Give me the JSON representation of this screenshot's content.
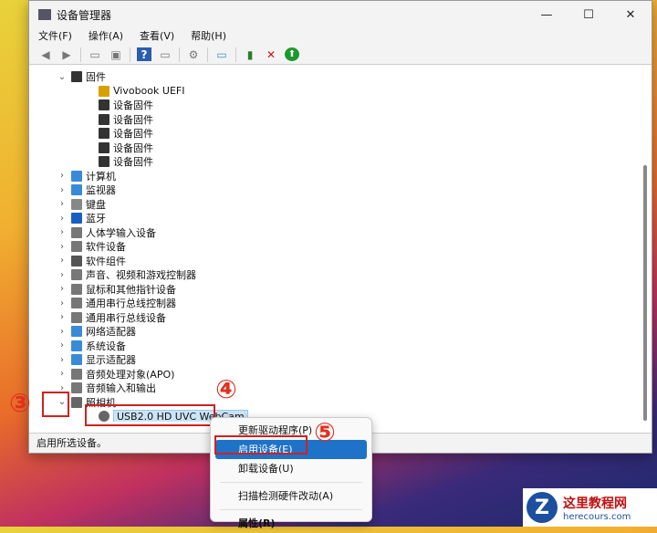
{
  "window": {
    "title": "设备管理器",
    "minimize": "—",
    "maximize": "☐",
    "close": "✕"
  },
  "menu": [
    "文件(F)",
    "操作(A)",
    "查看(V)",
    "帮助(H)"
  ],
  "tree": [
    {
      "label": "固件",
      "level": 0,
      "exp": "⌄",
      "color": "#333"
    },
    {
      "label": "Vivobook UEFI",
      "level": 1,
      "exp": "",
      "color": "#d9a000"
    },
    {
      "label": "设备固件",
      "level": 1,
      "exp": "",
      "color": "#333"
    },
    {
      "label": "设备固件",
      "level": 1,
      "exp": "",
      "color": "#333"
    },
    {
      "label": "设备固件",
      "level": 1,
      "exp": "",
      "color": "#333"
    },
    {
      "label": "设备固件",
      "level": 1,
      "exp": "",
      "color": "#333"
    },
    {
      "label": "设备固件",
      "level": 1,
      "exp": "",
      "color": "#333"
    },
    {
      "label": "计算机",
      "level": 0,
      "exp": "›",
      "color": "#3a8ad8"
    },
    {
      "label": "监视器",
      "level": 0,
      "exp": "›",
      "color": "#3a8ad8"
    },
    {
      "label": "键盘",
      "level": 0,
      "exp": "›",
      "color": "#888"
    },
    {
      "label": "蓝牙",
      "level": 0,
      "exp": "›",
      "color": "#1a5fc0"
    },
    {
      "label": "人体学输入设备",
      "level": 0,
      "exp": "›",
      "color": "#777"
    },
    {
      "label": "软件设备",
      "level": 0,
      "exp": "›",
      "color": "#777"
    },
    {
      "label": "软件组件",
      "level": 0,
      "exp": "›",
      "color": "#555"
    },
    {
      "label": "声音、视频和游戏控制器",
      "level": 0,
      "exp": "›",
      "color": "#777"
    },
    {
      "label": "鼠标和其他指针设备",
      "level": 0,
      "exp": "›",
      "color": "#777"
    },
    {
      "label": "通用串行总线控制器",
      "level": 0,
      "exp": "›",
      "color": "#777"
    },
    {
      "label": "通用串行总线设备",
      "level": 0,
      "exp": "›",
      "color": "#777"
    },
    {
      "label": "网络适配器",
      "level": 0,
      "exp": "›",
      "color": "#3a8ad8"
    },
    {
      "label": "系统设备",
      "level": 0,
      "exp": "›",
      "color": "#3a8ad8"
    },
    {
      "label": "显示适配器",
      "level": 0,
      "exp": "›",
      "color": "#3a8ad8"
    },
    {
      "label": "音频处理对象(APO)",
      "level": 0,
      "exp": "›",
      "color": "#777"
    },
    {
      "label": "音频输入和输出",
      "level": 0,
      "exp": "›",
      "color": "#777"
    },
    {
      "label": "照相机",
      "level": 0,
      "exp": "⌄",
      "color": "#666"
    },
    {
      "label": "USB2.0 HD UVC WebCam",
      "level": 1,
      "exp": "",
      "color": "#666",
      "selected": true
    }
  ],
  "status": "启用所选设备。",
  "context_menu": {
    "items": [
      "更新驱动程序(P)",
      "启用设备(E)",
      "卸载设备(U)",
      "扫描检测硬件改动(A)",
      "属性(R)"
    ]
  },
  "annotations": [
    "③",
    "④",
    "⑤"
  ],
  "watermark": {
    "icon": "Z",
    "title": "这里教程网",
    "url": "herecours.com"
  }
}
